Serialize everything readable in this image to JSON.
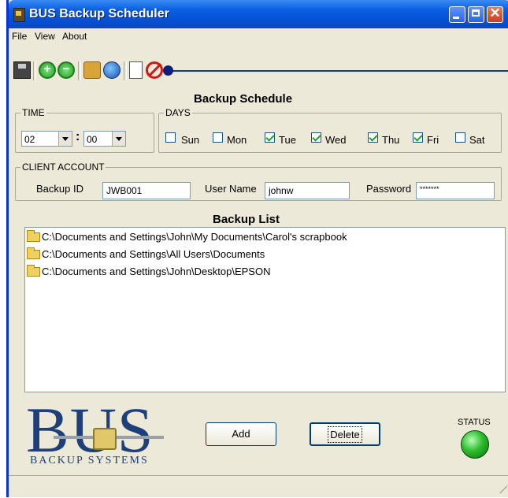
{
  "window": {
    "title": "BUS Backup Scheduler"
  },
  "menu": [
    "File",
    "View",
    "About"
  ],
  "toolbar": {
    "icons": [
      "save-icon",
      "add-icon",
      "remove-icon",
      "lock-icon",
      "globe-icon",
      "new-document-icon",
      "stop-icon"
    ],
    "slider_level": 0
  },
  "schedule": {
    "title": "Backup Schedule",
    "time": {
      "legend": "TIME",
      "hour": "02",
      "minute": "00",
      "separator": ":"
    },
    "days": {
      "legend": "DAYS",
      "items": [
        {
          "label": "Sun",
          "checked": false
        },
        {
          "label": "Mon",
          "checked": false
        },
        {
          "label": "Tue",
          "checked": true
        },
        {
          "label": "Wed",
          "checked": true
        },
        {
          "label": "Thu",
          "checked": true
        },
        {
          "label": "Fri",
          "checked": true
        },
        {
          "label": "Sat",
          "checked": false
        }
      ]
    }
  },
  "client": {
    "legend": "CLIENT ACCOUNT",
    "backup_id_label": "Backup ID",
    "backup_id": "JWB001",
    "username_label": "User Name",
    "username": "johnw",
    "password_label": "Password",
    "password": "*******"
  },
  "backup_list": {
    "title": "Backup List",
    "items": [
      "C:\\Documents and Settings\\John\\My Documents\\Carol's scrapbook",
      "C:\\Documents and Settings\\All Users\\Documents",
      "C:\\Documents and Settings\\John\\Desktop\\EPSON"
    ]
  },
  "logo": {
    "name": "BUS",
    "tagline": "BACKUP SYSTEMS"
  },
  "buttons": {
    "add": "Add",
    "delete": "Delete"
  },
  "status": {
    "label": "STATUS",
    "color": "#2ebd2e"
  },
  "colors": {
    "titlebar": "#0551d4",
    "window_bg": "#ece9d8"
  }
}
